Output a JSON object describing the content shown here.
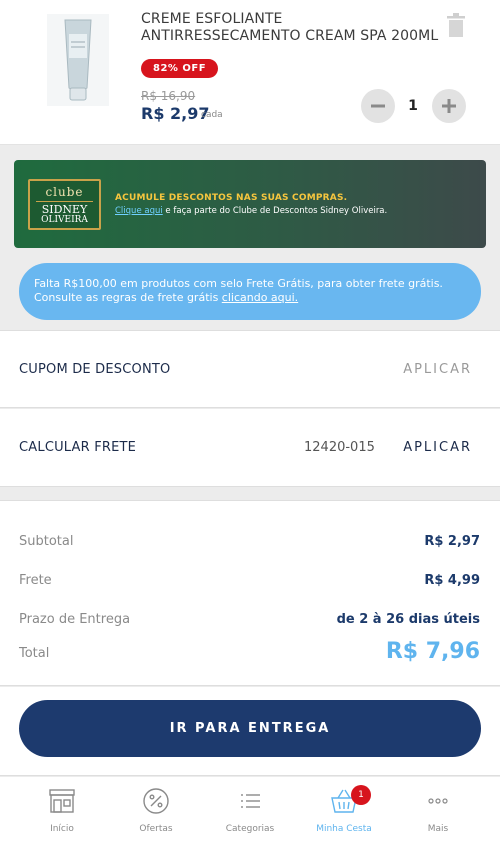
{
  "product": {
    "name": "CREME ESFOLIANTE ANTIRRESSECAMENTO CREAM SPA 200ML",
    "discount_badge": "82% OFF",
    "old_price": "R$ 16,90",
    "price": "R$ 2,97",
    "price_unit": "cada",
    "quantity": "1"
  },
  "club_banner": {
    "logo_top": "clube",
    "logo_mid": "SIDNEY",
    "logo_bottom": "OLIVEIRA",
    "title": "ACUMULE DESCONTOS NAS SUAS COMPRAS.",
    "link_text": "Clique aqui",
    "text": " e faça parte do Clube de Descontos Sidney Oliveira."
  },
  "free_shipping_notice": {
    "line1": "Falta R$100,00 em produtos com selo Frete Grátis, para obter frete grátis.",
    "line2_prefix": "Consulte as regras de frete grátis ",
    "line2_link": "clicando aqui."
  },
  "coupon": {
    "label": "CUPOM DE DESCONTO",
    "action": "APLICAR"
  },
  "shipping": {
    "label": "CALCULAR FRETE",
    "zip": "12420-015",
    "action": "APLICAR"
  },
  "summary": {
    "subtotal_label": "Subtotal",
    "subtotal_value": "R$ 2,97",
    "shipping_label": "Frete",
    "shipping_value": "R$ 4,99",
    "delivery_label": "Prazo de Entrega",
    "delivery_value": "de 2 à 26 dias úteis",
    "total_label": "Total",
    "total_value": "R$ 7,96"
  },
  "checkout": {
    "label": "IR PARA ENTREGA"
  },
  "nav": {
    "items": [
      {
        "label": "Início",
        "icon": "store-icon"
      },
      {
        "label": "Ofertas",
        "icon": "percent-badge-icon"
      },
      {
        "label": "Categorias",
        "icon": "list-icon"
      },
      {
        "label": "Minha Cesta",
        "icon": "basket-icon"
      },
      {
        "label": "Mais",
        "icon": "more-dots-icon"
      }
    ],
    "cart_count": "1"
  },
  "colors": {
    "primary": "#1d3a6e",
    "accent": "#5fb4ee",
    "badge": "#d7141d",
    "club_green": "#1f6b3e"
  }
}
